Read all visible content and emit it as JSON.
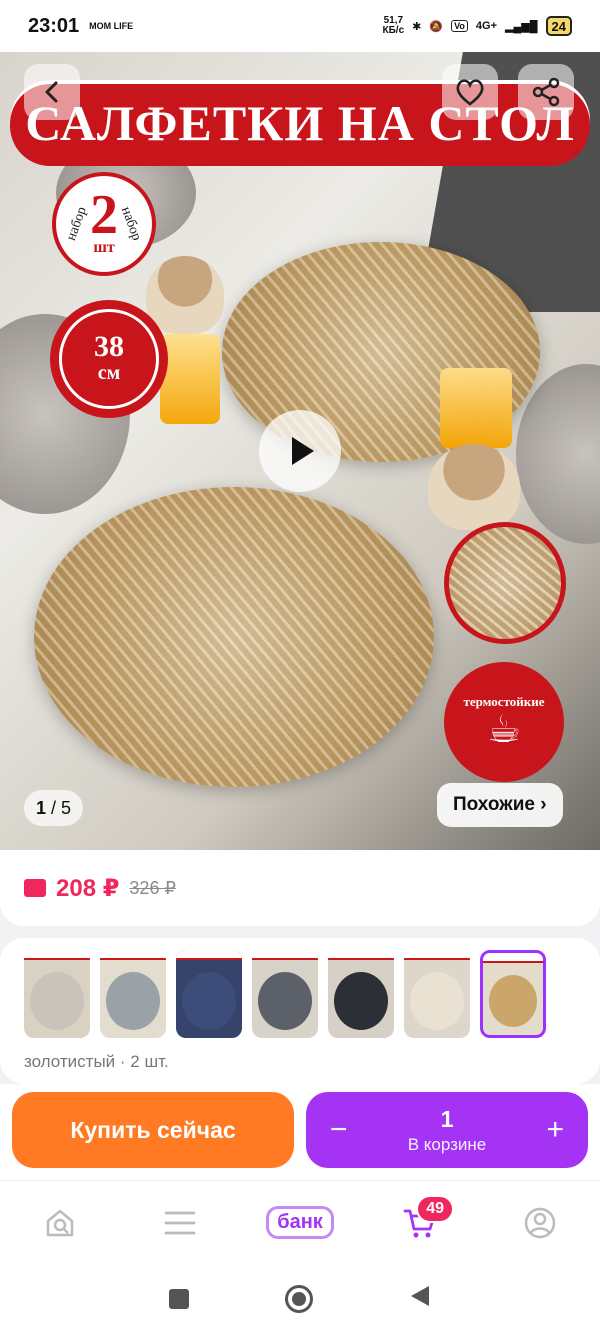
{
  "status_bar": {
    "time": "23:01",
    "carrier_logo": "MOM LIFE",
    "net_speed": "51,7",
    "net_unit": "КБ/с",
    "network": "4G+",
    "battery": "24"
  },
  "hero": {
    "banner_title": "САЛФЕТКИ НА СТОЛ",
    "badge_set_side_left": "набор",
    "badge_set_side_right": "набор",
    "badge_set_number": "2",
    "badge_set_unit": "шт",
    "badge_size_number": "38",
    "badge_size_unit": "см",
    "badge_heat_label": "термостойкие",
    "counter_current": "1",
    "counter_total": "/ 5",
    "similar_label": "Похожие ›"
  },
  "price": {
    "current": "208 ₽",
    "old": "326 ₽"
  },
  "variants": {
    "label": "золотистый · 2 шт.",
    "thumbs": [
      {
        "bg": "#d9d2c2",
        "mat": "#c9c4ba"
      },
      {
        "bg": "#e3ddcf",
        "mat": "#9aa2a7"
      },
      {
        "bg": "#36436a",
        "mat": "#3c4d7a"
      },
      {
        "bg": "#d8d3c9",
        "mat": "#5c6169"
      },
      {
        "bg": "#d6d0c6",
        "mat": "#2c2f36"
      },
      {
        "bg": "#ddd7cb",
        "mat": "#e9e2d2"
      },
      {
        "bg": "#e4dccb",
        "mat": "#caa66b"
      }
    ]
  },
  "actions": {
    "buy_now": "Купить сейчас",
    "minus": "−",
    "qty": "1",
    "in_cart": "В корзине",
    "plus": "+"
  },
  "bottom_nav": {
    "bank_label": "банк",
    "cart_count": "49"
  },
  "colors": {
    "accent_purple": "#a433f3",
    "accent_orange": "#ff7a22",
    "price_pink": "#f0275f",
    "brand_red": "#c8151b"
  }
}
